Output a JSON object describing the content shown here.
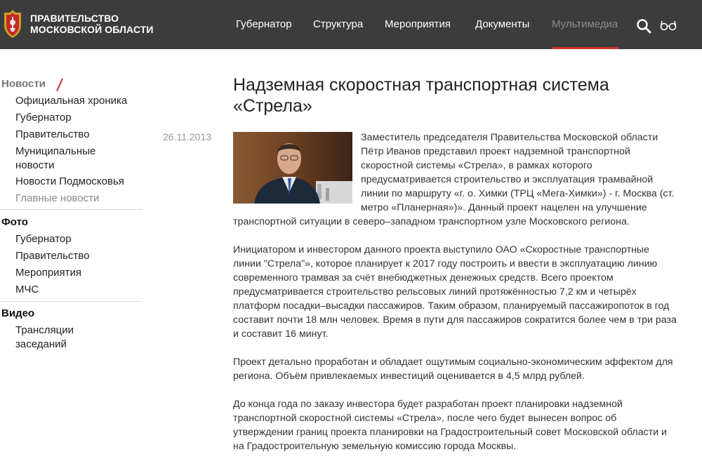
{
  "header": {
    "brand_line1": "ПРАВИТЕЛЬСТВО",
    "brand_line2": "МОСКОВСКОЙ ОБЛАСТИ",
    "nav": [
      "Губернатор",
      "Структура",
      "Мероприятия",
      "Документы",
      "Мультимедиа"
    ],
    "active_nav": "Мультимедиа",
    "colors": {
      "bar": "#3c3c3c",
      "accent": "#d32f2f"
    }
  },
  "sidebar": {
    "news_title": "Новости",
    "news_items": [
      "Официальная хроника",
      "Губернатор",
      "Правительство",
      "Муниципальные новости",
      "Новости Подмосковья",
      "Главные новости"
    ],
    "photo_title": "Фото",
    "photo_items": [
      "Губернатор",
      "Правительство",
      "Мероприятия",
      "МЧС"
    ],
    "video_title": "Видео",
    "video_items": [
      "Трансляции заседаний"
    ]
  },
  "article": {
    "date": "26.11.2013",
    "title": "Надземная скоростная транспортная система «Стрела»",
    "paragraphs": [
      "Заместитель председателя Правительства Московской области Пётр Иванов представил проект надземной транспортной скоростной системы «Стрела», в рамках которого предусматривается строительство и эксплуатация трамвайной линии по маршруту «г. о. Химки (ТРЦ «Мега-Химки») - г. Москва (ст. метро «Планерная»)». Данный проект нацелен на улучшение транспортной ситуации в северо–западном транспортном узле Московского региона.",
      "Инициатором и инвестором данного проекта выступило ОАО «Скоростные транспортные линии \"Стрела\"», которое планирует к 2017 году построить и ввести в эксплуатацию линию современного трамвая за счёт внебюджетных денежных средств. Всего проектом предусматривается строительство рельсовых линий протяжённостью 7,2 км и четырёх платформ посадки–высадки пассажиров. Таким образом, планируемый пассажиропоток в год составит почти 18 млн человек. Время в пути для пассажиров сократится более чем в три раза и составит 16 минут.",
      "Проект детально проработан и обладает ощутимым социально-экономическим эффектом для региона. Объём привлекаемых инвестиций оценивается в 4,5 млрд рублей.",
      "До конца года по заказу инвестора будет разработан проект планировки надземной транспортной скоростной системы «Стрела», после чего будет вынесен вопрос об утверждении границ проекта планировки на Градостроительный совет Московской области и на Градостроительную земельную комиссию города Москвы."
    ]
  }
}
